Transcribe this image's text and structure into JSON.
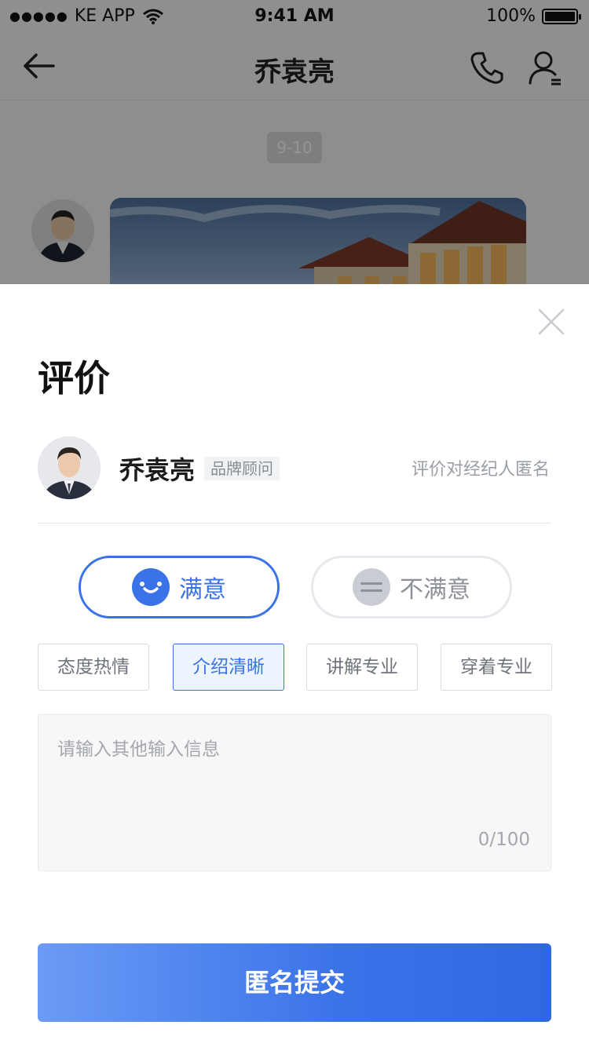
{
  "status_bar": {
    "carrier": "KE APP",
    "time": "9:41 AM",
    "battery": "100%"
  },
  "nav": {
    "title": "乔袁亮",
    "back_icon": "arrow-left-icon",
    "phone_icon": "phone-icon",
    "profile_icon": "user-profile-icon"
  },
  "chat": {
    "time_chip": "9-10"
  },
  "sheet": {
    "title": "评价",
    "close_icon": "close-icon",
    "agent": {
      "name": "乔袁亮",
      "role": "品牌顾问",
      "anon_note": "评价对经纪人匿名"
    },
    "ratings": [
      {
        "label": "满意",
        "icon": "smile-icon",
        "selected": true
      },
      {
        "label": "不满意",
        "icon": "neutral-face-icon",
        "selected": false
      }
    ],
    "tags": [
      {
        "label": "态度热情",
        "selected": false
      },
      {
        "label": "介绍清晰",
        "selected": true
      },
      {
        "label": "讲解专业",
        "selected": false
      },
      {
        "label": "穿着专业",
        "selected": false
      }
    ],
    "comment": {
      "placeholder": "请输入其他输入信息",
      "value": "",
      "counter": "0/100"
    },
    "submit_label": "匿名提交"
  },
  "colors": {
    "accent": "#3a72e8",
    "selected_tag_bg": "#eef4fe",
    "overlay": "rgba(0,0,0,0.42)"
  }
}
